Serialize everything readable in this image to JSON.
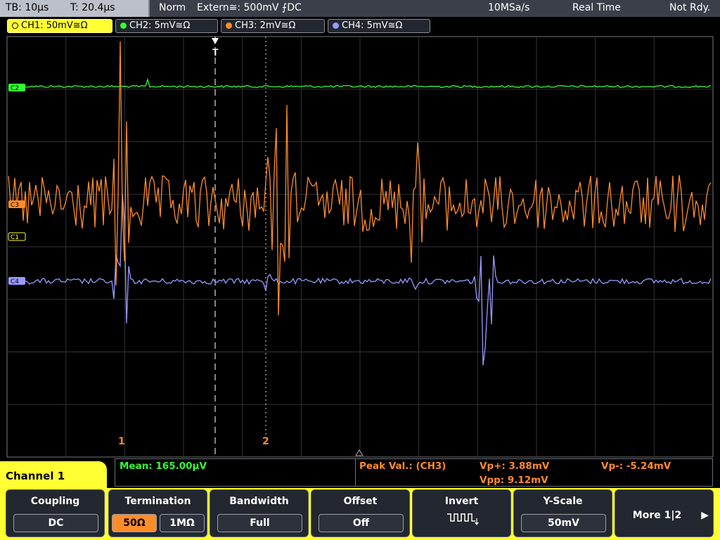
{
  "topbar": {
    "timebase": "TB: 10µs",
    "trigger_time": "T: 20.4µs",
    "mode": "Norm",
    "trigger_source": "Extern≅: 500mV ⨍DC",
    "sample_rate": "10MSa/s",
    "acq_mode": "Real Time",
    "status": "Not Rdy."
  },
  "channels": [
    {
      "label": "CH1: 50mV≅Ω",
      "color": "#ffff33",
      "active": true
    },
    {
      "label": "CH2: 5mV≅Ω",
      "color": "#33ff33",
      "active": false
    },
    {
      "label": "CH3: 2mV≅Ω",
      "color": "#ff8c2a",
      "active": false
    },
    {
      "label": "CH4: 5mV≅Ω",
      "color": "#9999ff",
      "active": false
    }
  ],
  "plot": {
    "trigger_label": "T",
    "marker_1": "1",
    "marker_2": "2",
    "ch_markers": [
      "C2",
      "C3",
      "C1",
      "C4"
    ]
  },
  "measurements": {
    "channel_title": "Channel 1",
    "mean": "Mean: 165.00µV",
    "peak_label": "Peak Val.: (CH3)",
    "vp_plus": "Vp+: 3.88mV",
    "vp_minus": "Vp-: -5.24mV",
    "vpp": "Vpp: 9.12mV"
  },
  "softkeys": {
    "coupling": {
      "title": "Coupling",
      "value": "DC"
    },
    "termination": {
      "title": "Termination",
      "opt1": "50Ω",
      "opt2": "1MΩ"
    },
    "bandwidth": {
      "title": "Bandwidth",
      "value": "Full"
    },
    "offset": {
      "title": "Offset",
      "value": "Off"
    },
    "invert": {
      "title": "Invert",
      "icon": "invert-pulse-icon"
    },
    "yscale": {
      "title": "Y-Scale",
      "value": "50mV"
    },
    "more": {
      "label": "More 1|2"
    }
  }
}
